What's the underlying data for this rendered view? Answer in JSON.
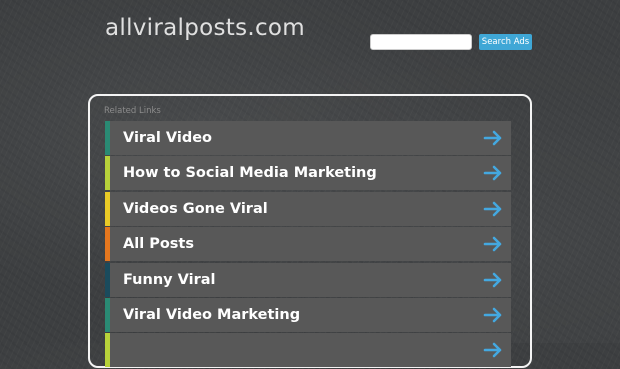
{
  "header": {
    "site_title": "allviralposts.com",
    "search_placeholder": "",
    "search_button_label": "Search Ads"
  },
  "related": {
    "label": "Related Links",
    "items": [
      {
        "label": "Viral Video",
        "accent": "#2a8a74"
      },
      {
        "label": "How to Social Media Marketing",
        "accent": "#b7d23a"
      },
      {
        "label": "Videos Gone Viral",
        "accent": "#eacb26"
      },
      {
        "label": "All Posts",
        "accent": "#e5771e"
      },
      {
        "label": "Funny Viral",
        "accent": "#1a4b5d"
      },
      {
        "label": "Viral Video Marketing",
        "accent": "#2a8a74"
      },
      {
        "label": "",
        "accent": "#b7d23a"
      }
    ],
    "arrow_icon": "arrow-right-icon",
    "arrow_color": "#44a8e0"
  }
}
